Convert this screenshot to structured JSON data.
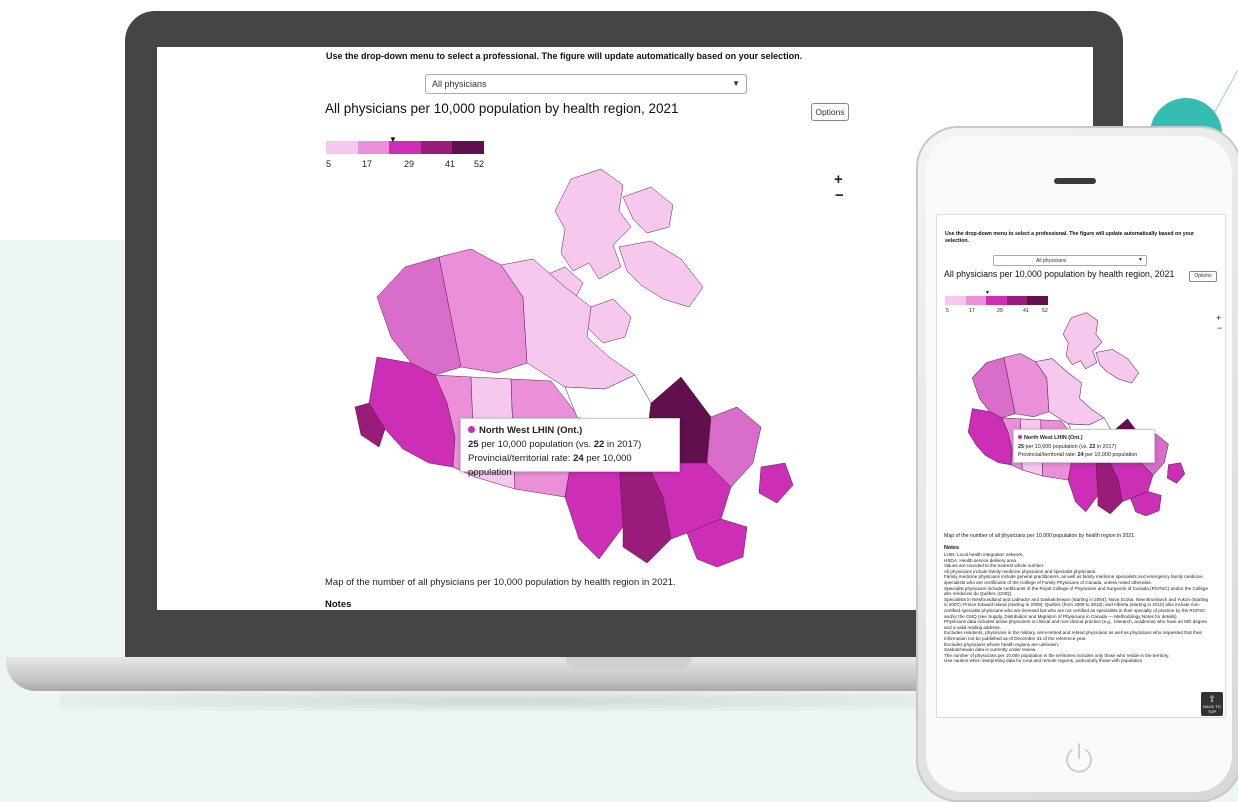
{
  "page": {
    "instruction": "Use the drop-down menu to select a professional. The figure will update automatically based on your selection.",
    "dropdown_value": "All physicians",
    "title": "All physicians per 10,000 population by health region, 2021",
    "options_label": "Options",
    "zoom_in": "+",
    "zoom_out": "−",
    "caption": "Map of the number of all physicians per 10,000 population by health region in 2021.",
    "notes_title": "Notes",
    "back_to_top": "BACK TO TOP"
  },
  "legend": {
    "ticks": [
      "5",
      "17",
      "29",
      "41",
      "52"
    ],
    "marker_value": 25,
    "colors": [
      "#f6c8ee",
      "#ea8fd8",
      "#cc2eb5",
      "#9a1c7a",
      "#610f4d"
    ]
  },
  "tooltip": {
    "region": "North West LHIN (Ont.)",
    "value": "25",
    "value_text": " per 10,000 population (vs. ",
    "prior_value": "22",
    "prior_text": " in 2017)",
    "prov_label": "Provincial/territorial rate: ",
    "prov_value": "24",
    "prov_unit": " per 10,000 population",
    "dot_color": "#cc2eb5"
  },
  "notes": [
    "LHIN: Local health integration network.",
    "HSDA: Health service delivery area.",
    "Values are rounded to the nearest whole number.",
    "All physicians include family medicine physicians and specialist physicians.",
    "Family medicine physicians include general practitioners, as well as family medicine specialists and emergency family medicine specialists who are certificants of the College of Family Physicians of Canada, unless noted otherwise.",
    "Specialist physicians include certificants of the Royal College of Physicians and Surgeons of Canada (RCPSC) and/or the Collège des médecins du Québec (CMQ).",
    "Specialists in Newfoundland and Labrador and Saskatchewan (starting in 2004); Nova Scotia, New Brunswick and Yukon (starting in 2007); Prince Edward Island (starting in 2009); Quebec (from 2009 to 2018); and Alberta (starting in 2010) also include non-certified specialist physicians who are licensed but who are not certified as specialists in their specialty of practice by the RCPSC and/or the CMQ (see Supply, Distribution and Migration of Physicians in Canada — Methodology Notes for details).",
    "Physicians data includes active physicians in clinical and non-clinical practice (e.g., research, academia) who have an MD degree and a valid mailing address.",
    "Excludes residents, physicians in the military, semi-retired and retired physicians as well as physicians who requested that their information not be published as of December 31 of the reference year.",
    "Excludes physicians whose health regions are unknown.",
    "Saskatchewan data is currently under review.",
    "The number of physicians per 10,000 population in the territories includes only those who reside in the territory.",
    "Use caution when interpreting data for rural and remote regions, particularly those with population"
  ]
}
